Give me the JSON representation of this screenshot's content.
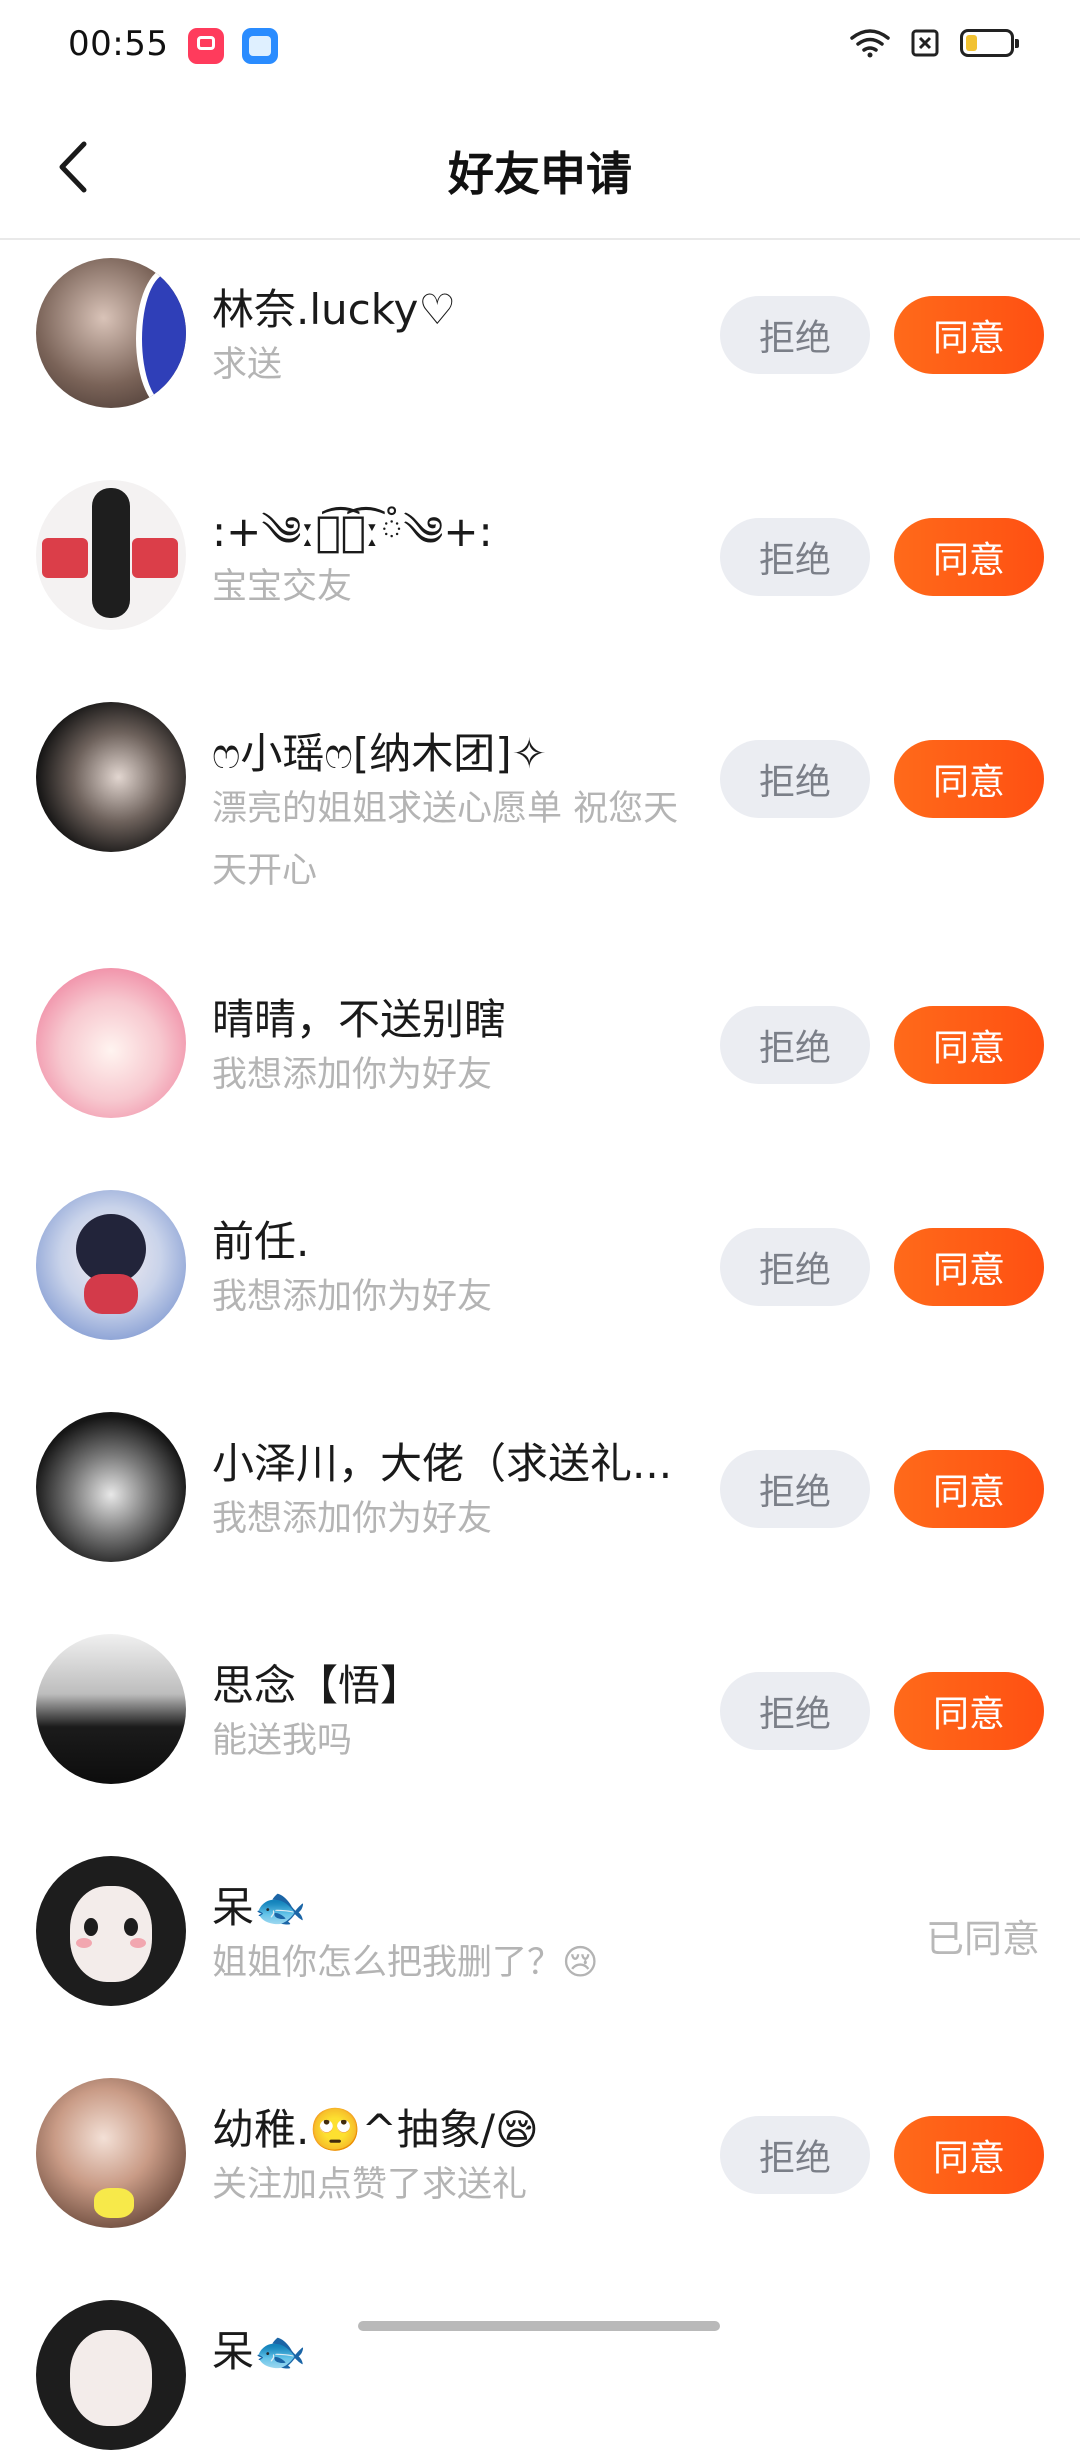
{
  "status_bar": {
    "time": "00:55",
    "icons": [
      "wifi-icon",
      "sim-off-icon",
      "battery-icon"
    ],
    "battery_level": 0.25
  },
  "header": {
    "title": "好友申请",
    "back_icon": "chevron-left-icon"
  },
  "buttons": {
    "reject_label": "拒绝",
    "accept_label": "同意"
  },
  "requests": [
    {
      "name": "林奈.lucky♡",
      "message": "求送",
      "state": "pending"
    },
    {
      "name": ":+༄ːཾ͡瑾͡ːཾ༄+:",
      "message": "宝宝交友",
      "state": "pending"
    },
    {
      "name": "ෆ小瑶ෆ[纳木团]✧",
      "message": "漂亮的姐姐求送心愿单 祝您天天开心",
      "state": "pending"
    },
    {
      "name": "晴晴，不送别瞎",
      "message": "我想添加你为好友",
      "state": "pending"
    },
    {
      "name": "前任.",
      "message": "我想添加你为好友",
      "state": "pending"
    },
    {
      "name": "小泽川，大佬（求送礼...",
      "message": "我想添加你为好友",
      "state": "pending"
    },
    {
      "name": "思念【悟】",
      "message": "能送我吗",
      "state": "pending"
    },
    {
      "name": "呆🐟",
      "message": "姐姐你怎么把我删了？😢",
      "state": "accepted",
      "state_label": "已同意"
    },
    {
      "name": "幼稚.🙄^抽象/😪",
      "message": "关注加点赞了求送礼",
      "state": "pending"
    },
    {
      "name": "呆🐟",
      "message": "",
      "state": "pending"
    }
  ],
  "colors": {
    "accept": "#ff5a14",
    "reject_bg": "#ebedf2",
    "muted_text": "#b4b4b4"
  }
}
